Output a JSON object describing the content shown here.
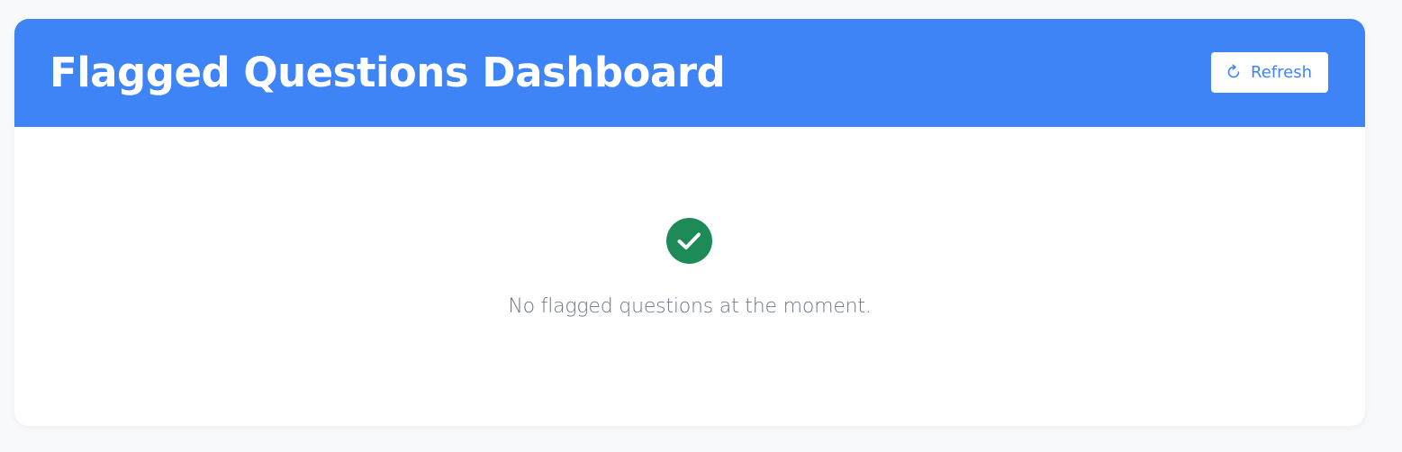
{
  "header": {
    "title": "Flagged Questions Dashboard",
    "refresh_label": "Refresh",
    "refresh_icon": "refresh-icon"
  },
  "empty_state": {
    "icon": "check-circle-icon",
    "message": "No flagged questions at the moment."
  },
  "colors": {
    "header_bg": "#3e84f6",
    "accent": "#3e84f6",
    "success": "#1e8a57",
    "muted_text": "#6b7686",
    "page_bg": "#f8f9fb"
  }
}
